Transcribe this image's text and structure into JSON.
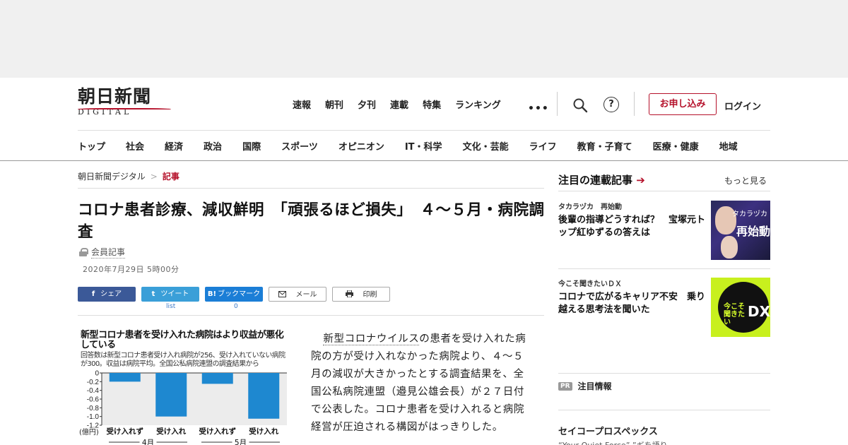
{
  "header": {
    "logo_jp": "朝日新聞",
    "logo_en": "DIGITAL",
    "top_nav": [
      "速報",
      "朝刊",
      "夕刊",
      "連載",
      "特集",
      "ランキング"
    ],
    "more_dots": "•••",
    "help_glyph": "?",
    "apply_label": "お申し込み",
    "login_label": "ログイン",
    "categories": [
      "トップ",
      "社会",
      "経済",
      "政治",
      "国際",
      "スポーツ",
      "オピニオン",
      "IT・科学",
      "文化・芸能",
      "ライフ",
      "教育・子育て",
      "医療・健康",
      "地域"
    ]
  },
  "breadcrumb": {
    "home": "朝日新聞デジタル",
    "sep": ">",
    "current": "記事"
  },
  "article": {
    "headline": "コロナ患者診療、減収鮮明　「頑張るほど損失」　４～５月・病院調査",
    "member_label": "会員記事",
    "date": "2020年7月29日 5時00分",
    "body_keyword": "新型コロナウイルス",
    "body_rest": "の患者を受け入れた病院の方が受け入れなかった病院より、４～５月の減収が大きかったとする調査結果を、全国公私病院連盟（邉見公雄会長）が２７日付で公表した。コロナ患者を受け入れると病院経営が圧迫される構図がはっきりした。"
  },
  "share": {
    "facebook": "シェア",
    "facebook_icon": "f",
    "twitter": "ツイート",
    "twitter_icon": "t",
    "hatena": "ブックマーク",
    "hatena_icon": "B!",
    "mail": "メール",
    "print": "印刷",
    "twitter_count": "list",
    "hatena_count": "0"
  },
  "chart_data": {
    "type": "bar",
    "title": "新型コロナ患者を受け入れた病院はより収益が悪化している",
    "subtitle": "回答数は新型コロナ患者受け入れ病院が256、受け入れていない病院が300。収益は病院平均。全国公私病院連盟の調査結果から",
    "categories": [
      "受け入れず",
      "受け入れ",
      "受け入れず",
      "受け入れ"
    ],
    "groups": [
      "4月",
      "5月"
    ],
    "values": [
      -0.2,
      -1.0,
      -0.25,
      -1.05
    ],
    "ylabel": "(億円)",
    "yticks": [
      "0",
      "-0.2",
      "-0.4",
      "-0.6",
      "-0.8",
      "-1.0",
      "-1.2"
    ],
    "ylim": [
      -1.2,
      0
    ],
    "color": "#1e88d0"
  },
  "sidebar": {
    "heading": "注目の連載記事",
    "arrow": "➔",
    "more": "もっと見る",
    "items": [
      {
        "tag": "タカラヅカ　再始動",
        "title": "後輩の指導どうすれば？　宝塚元トップ紅ゆずるの答えは",
        "img_text_small": "タカラヅカ",
        "img_text_big": "再始動"
      },
      {
        "tag": "今こそ聞きたいＤＸ",
        "title": "コロナで広がるキャリア不安　乗り越える思考法を聞いた",
        "img_text_small": "今こそ聞きたい",
        "img_text_big": "DX"
      }
    ],
    "pr_badge": "PR",
    "pr_label": "注目情報",
    "seiko_title": "セイコープロスペックス",
    "seiko_sub": "“Your Quiet Force” ”ギを語り"
  }
}
